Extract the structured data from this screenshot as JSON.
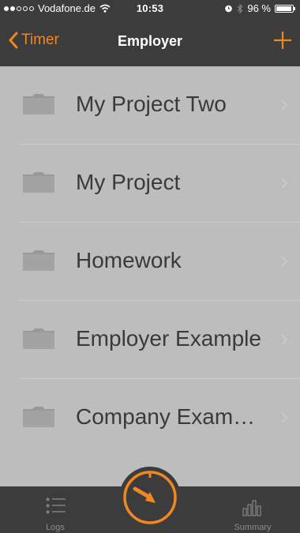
{
  "status_bar": {
    "carrier": "Vodafone.de",
    "time": "10:53",
    "battery_text": "96 %",
    "battery_level": 0.96,
    "signal_bars_filled": 2,
    "signal_bars_total": 5
  },
  "nav": {
    "back_label": "Timer",
    "title": "Employer",
    "add_icon": "plus-icon"
  },
  "projects": [
    {
      "label": "My Project Two",
      "icon": "folder-icon"
    },
    {
      "label": "My Project",
      "icon": "folder-icon"
    },
    {
      "label": "Homework",
      "icon": "folder-icon"
    },
    {
      "label": "Employer Example",
      "icon": "folder-icon"
    },
    {
      "label": "Company Exam…",
      "icon": "folder-icon"
    }
  ],
  "tabs": {
    "logs": {
      "label": "Logs",
      "icon": "list-stars-icon"
    },
    "summary": {
      "label": "Summary",
      "icon": "bar-chart-icon"
    },
    "timer": {
      "icon": "stopwatch-icon"
    }
  },
  "colors": {
    "accent": "#f0871f",
    "bar_background": "#3c3c3c",
    "list_background": "#bdbdbd",
    "tab_label": "#8c8c8c"
  }
}
